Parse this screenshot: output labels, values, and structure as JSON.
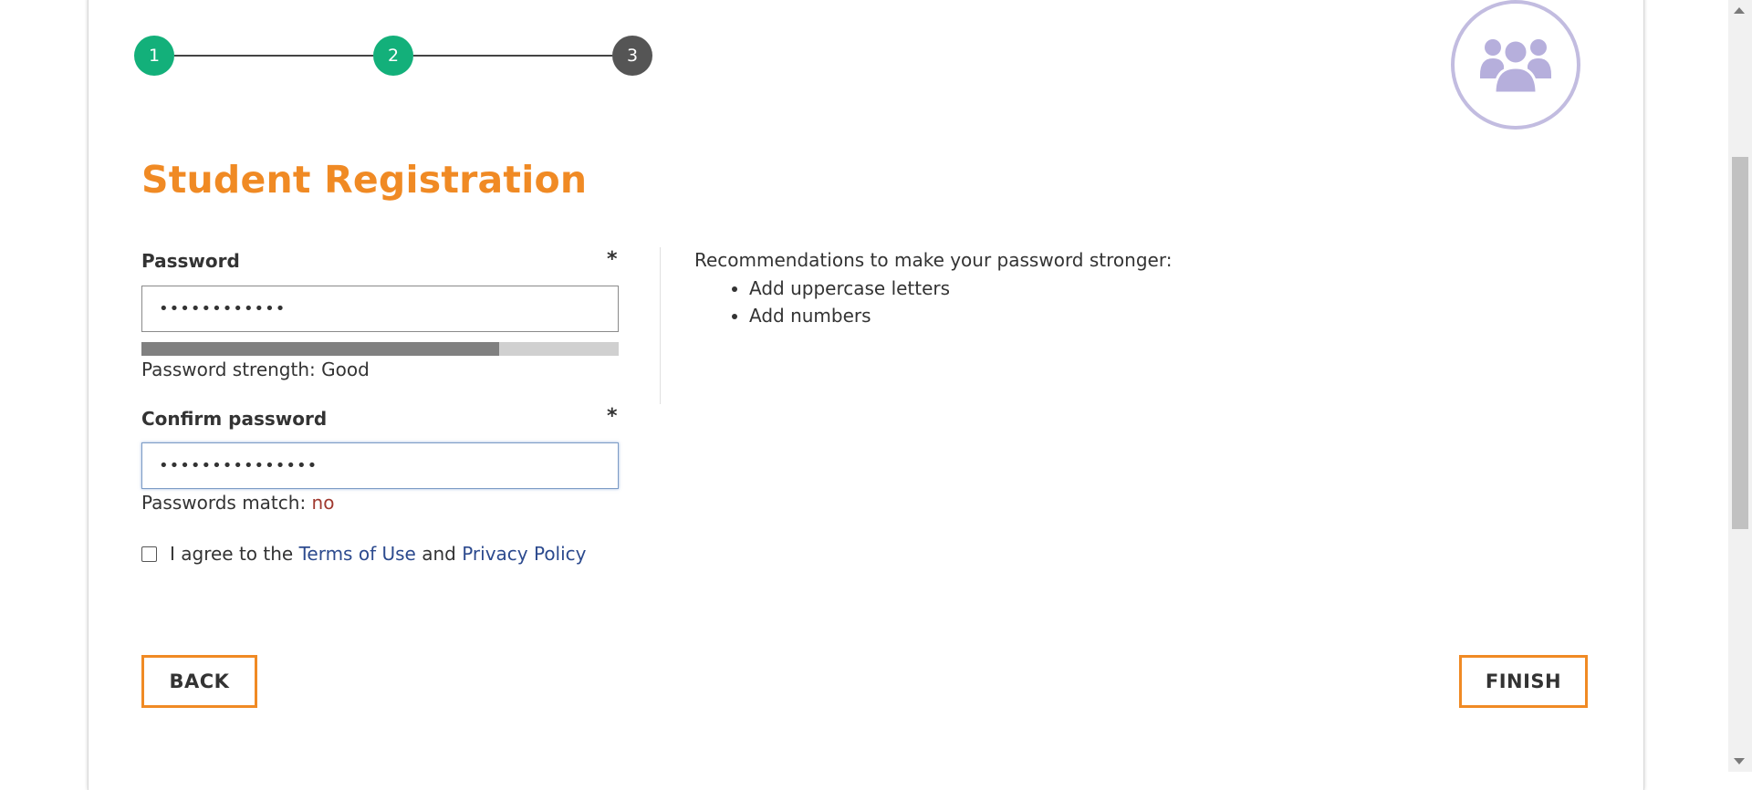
{
  "stepper": {
    "steps": [
      {
        "label": "1",
        "state": "done"
      },
      {
        "label": "2",
        "state": "done"
      },
      {
        "label": "3",
        "state": "current"
      }
    ],
    "done_color": "#13b07a",
    "current_color": "#555555"
  },
  "badge": {
    "icon": "users-group-icon",
    "color": "#c2bce0"
  },
  "page": {
    "title": "Student Registration",
    "accent_color": "#f08a24"
  },
  "password": {
    "label": "Password",
    "required_mark": "*",
    "value": "••••••••••••",
    "strength_fraction": 0.75,
    "strength_text": "Password strength: Good"
  },
  "confirm": {
    "label": "Confirm password",
    "required_mark": "*",
    "value": "•••••••••••••••",
    "match_label": "Passwords match:",
    "match_value": "no"
  },
  "recommendations": {
    "heading": "Recommendations to make your password stronger:",
    "items": [
      "Add uppercase letters",
      "Add numbers"
    ]
  },
  "agreement": {
    "prefix": "I agree to the",
    "terms_link": "Terms of Use",
    "conjunction": "and",
    "privacy_link": "Privacy Policy",
    "checked": false
  },
  "buttons": {
    "back": "BACK",
    "finish": "FINISH"
  }
}
